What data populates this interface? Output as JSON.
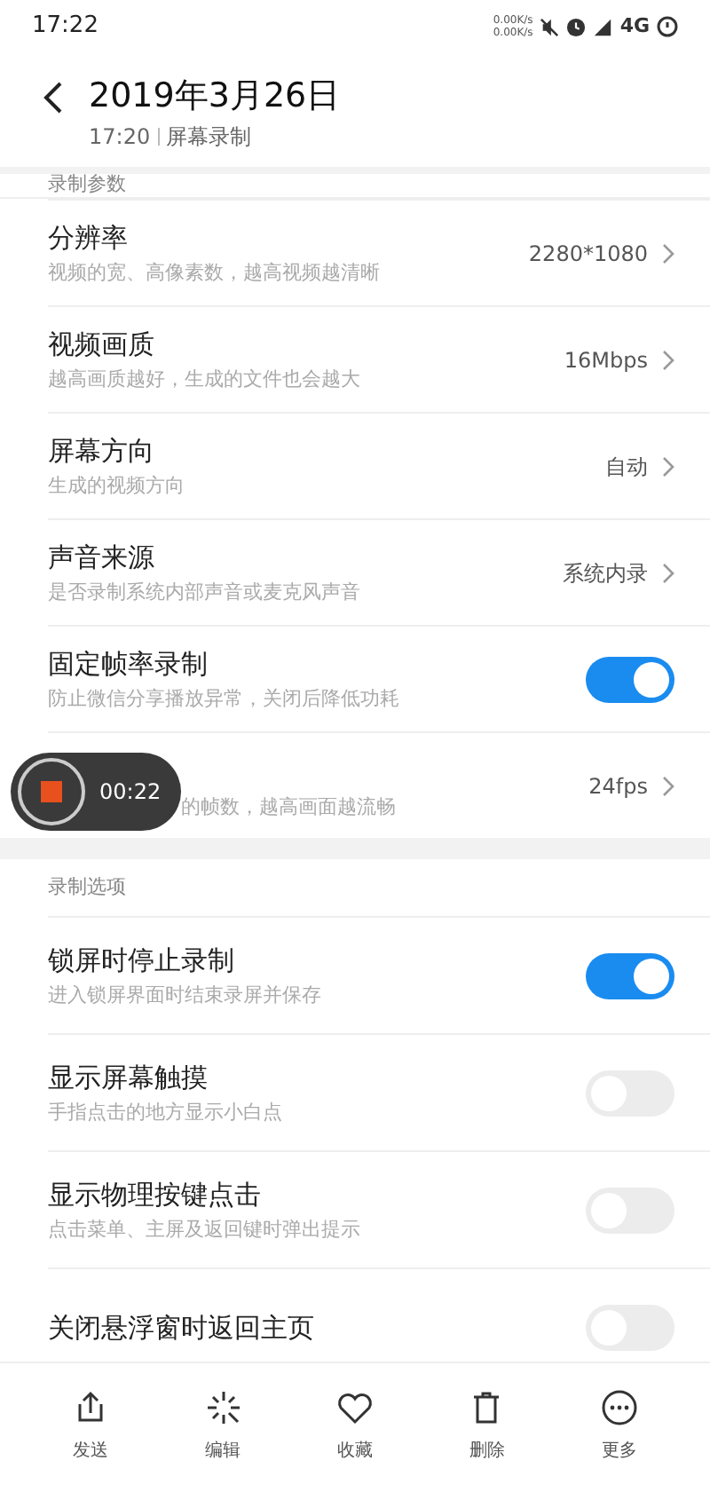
{
  "status_bar": {
    "time": "17:22",
    "speed_up": "0.00K/s",
    "speed_down": "0.00K/s",
    "network": "4G"
  },
  "header": {
    "title": "2019年3月26日",
    "time": "17:20",
    "app": "屏幕录制"
  },
  "sections": [
    {
      "label": "录制参数",
      "rows": [
        {
          "kind": "value",
          "title": "分辨率",
          "subtitle": "视频的宽、高像素数，越高视频越清晰",
          "value": "2280*1080"
        },
        {
          "kind": "value",
          "title": "视频画质",
          "subtitle": "越高画质越好，生成的文件也会越大",
          "value": "16Mbps"
        },
        {
          "kind": "value",
          "title": "屏幕方向",
          "subtitle": "生成的视频方向",
          "value": "自动"
        },
        {
          "kind": "value",
          "title": "声音来源",
          "subtitle": "是否录制系统内部声音或麦克风声音",
          "value": "系统内录"
        },
        {
          "kind": "toggle",
          "title": "固定帧率录制",
          "subtitle": "防止微信分享播放异常，关闭后降低功耗",
          "on": true
        },
        {
          "kind": "value",
          "subtitle": "的帧数，越高画面越流畅",
          "value": "24fps"
        }
      ]
    },
    {
      "label": "录制选项",
      "rows": [
        {
          "kind": "toggle",
          "title": "锁屏时停止录制",
          "subtitle": "进入锁屏界面时结束录屏并保存",
          "on": true
        },
        {
          "kind": "toggle",
          "title": "显示屏幕触摸",
          "subtitle": "手指点击的地方显示小白点",
          "on": false
        },
        {
          "kind": "toggle",
          "title": "显示物理按键点击",
          "subtitle": "点击菜单、主屏及返回键时弹出提示",
          "on": false
        },
        {
          "kind": "toggle",
          "title": "关闭悬浮窗时返回主页",
          "on": false
        }
      ]
    }
  ],
  "recording": {
    "elapsed": "00:22"
  },
  "bottom_bar": [
    {
      "kind": "send",
      "label": "发送"
    },
    {
      "kind": "edit",
      "label": "编辑"
    },
    {
      "kind": "favorite",
      "label": "收藏"
    },
    {
      "kind": "delete",
      "label": "删除"
    },
    {
      "kind": "more",
      "label": "更多"
    }
  ]
}
